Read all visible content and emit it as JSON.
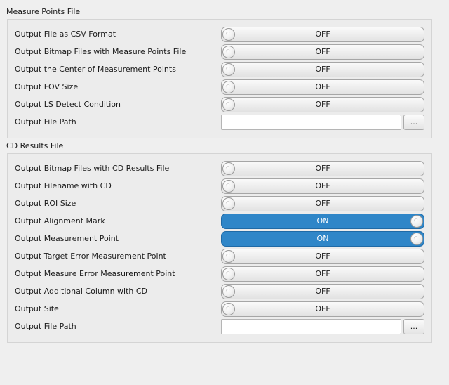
{
  "measure_points": {
    "title": "Measure Points File",
    "toggles": [
      {
        "label": "Output File as CSV Format",
        "state": "OFF"
      },
      {
        "label": "Output Bitmap Files with Measure Points File",
        "state": "OFF"
      },
      {
        "label": "Output the Center of Measurement Points",
        "state": "OFF"
      },
      {
        "label": "Output FOV Size",
        "state": "OFF"
      },
      {
        "label": "Output LS Detect Condition",
        "state": "OFF"
      }
    ],
    "file_path": {
      "label": "Output File Path",
      "value": "",
      "browse_label": "..."
    }
  },
  "cd_results": {
    "title": "CD Results File",
    "toggles": [
      {
        "label": "Output Bitmap Files with CD Results File",
        "state": "OFF"
      },
      {
        "label": "Output Filename with CD",
        "state": "OFF"
      },
      {
        "label": "Output ROI Size",
        "state": "OFF"
      },
      {
        "label": "Output Alignment Mark",
        "state": "ON"
      },
      {
        "label": "Output Measurement Point",
        "state": "ON"
      },
      {
        "label": "Output Target Error Measurement Point",
        "state": "OFF"
      },
      {
        "label": "Output Measure Error Measurement Point",
        "state": "OFF"
      },
      {
        "label": "Output Additional Column with CD",
        "state": "OFF"
      },
      {
        "label": "Output Site",
        "state": "OFF"
      }
    ],
    "file_path": {
      "label": "Output File Path",
      "value": "",
      "browse_label": "..."
    }
  },
  "colors": {
    "toggle_on": "#2f86c8",
    "toggle_off": "#eeeeee",
    "background": "#efefef"
  }
}
